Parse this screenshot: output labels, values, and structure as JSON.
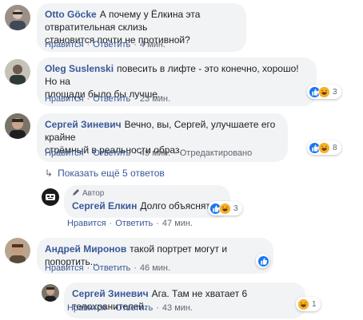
{
  "labels": {
    "like": "Нравится",
    "reply": "Ответить",
    "separator": "·",
    "author_badge": "Автор",
    "more_replies": "Показать ещё 5 ответов"
  },
  "comments": [
    {
      "author": "Otto Göcke",
      "line1": "А почему у Ёлкина эта отвратительная склизь",
      "line2": "становится почти не противной?",
      "time": "4 мин."
    },
    {
      "author": "Oleg Suslenski",
      "line1": "повесить в лифте - это конечно, хорошо! Но на",
      "line2": "площади было бы лучше..",
      "time": "23 мин.",
      "reaction_count": "3"
    },
    {
      "author": "Сергей Зиневич",
      "line1": "Вечно, вы, Сергей, улучшаете его крайне",
      "line2": "стрёмный в реальности образ.",
      "time": "49 мин.",
      "edited": "Отредактировано",
      "reaction_count": "8"
    },
    {
      "author": "Сергей Елкин",
      "text": "Долго объяснять.",
      "time": "47 мин.",
      "reaction_count": "3"
    },
    {
      "author": "Андрей Миронов",
      "text": "такой портрет могут и попортить...",
      "time": "46 мин."
    },
    {
      "author": "Сергей Зиневич",
      "text": "Ага. Там не хватает 6 телохранителей.",
      "time": "43 мин.",
      "reaction_count": "1"
    }
  ],
  "colors": {
    "link": "#385898",
    "bubble": "#f2f3f5",
    "meta": "#606770",
    "like": "#1877f2",
    "haha": "#f7b125"
  }
}
